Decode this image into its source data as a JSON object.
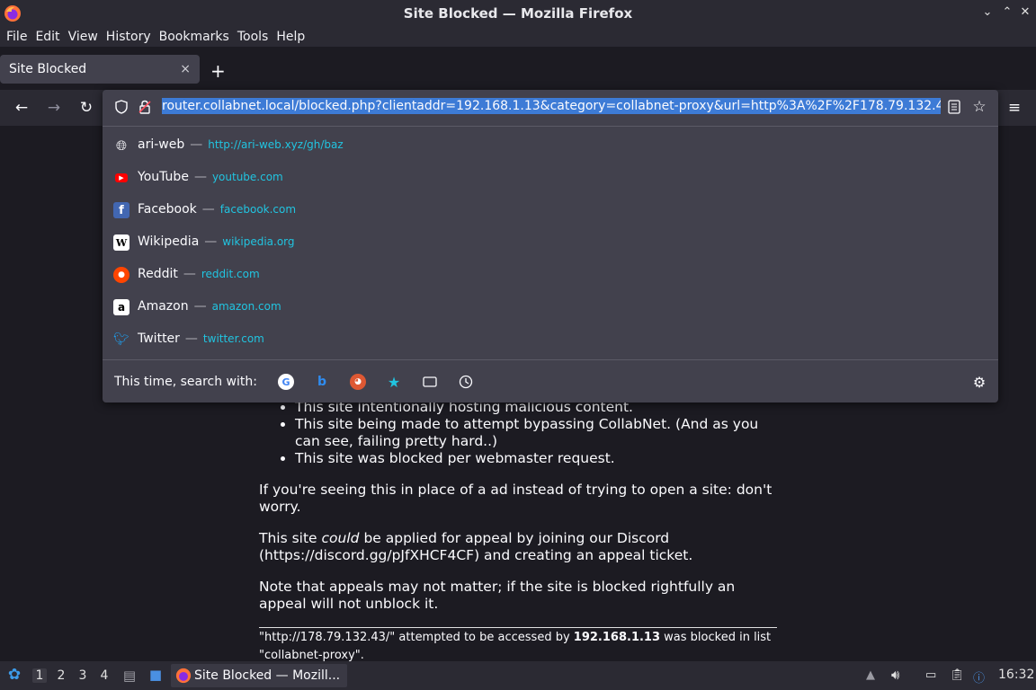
{
  "window": {
    "title": "Site Blocked — Mozilla Firefox"
  },
  "menu": [
    "File",
    "Edit",
    "View",
    "History",
    "Bookmarks",
    "Tools",
    "Help"
  ],
  "tab": {
    "title": "Site Blocked",
    "close": "×"
  },
  "urlbar": {
    "url": "router.collabnet.local/blocked.php?clientaddr=192.168.1.13&category=collabnet-proxy&url=http%3A%2F%2F178.79.132.4"
  },
  "suggestions": [
    {
      "name": "ari-web",
      "url": "http://ari-web.xyz/gh/baz",
      "icon": "globe-icon"
    },
    {
      "name": "YouTube",
      "url": "youtube.com",
      "icon": "youtube-icon"
    },
    {
      "name": "Facebook",
      "url": "facebook.com",
      "icon": "facebook-icon"
    },
    {
      "name": "Wikipedia",
      "url": "wikipedia.org",
      "icon": "wikipedia-icon"
    },
    {
      "name": "Reddit",
      "url": "reddit.com",
      "icon": "reddit-icon"
    },
    {
      "name": "Amazon",
      "url": "amazon.com",
      "icon": "amazon-icon"
    },
    {
      "name": "Twitter",
      "url": "twitter.com",
      "icon": "twitter-icon"
    }
  ],
  "search_with": {
    "label": "This time, search with:"
  },
  "page": {
    "bullets": [
      "This site intentionally hosting malicious content.",
      "This site being made to attempt bypassing CollabNet. (And as you can see, failing pretty hard..)",
      "This site was blocked per webmaster request."
    ],
    "para1": "If you're seeing this in place of a ad instead of trying to open a site: don't worry.",
    "para2_pre": "This site ",
    "para2_em": "could",
    "para2_post": " be applied for appeal by joining our Discord (https://discord.gg/pJfXHCF4CF) and creating an appeal ticket.",
    "para3": "Note that appeals may not matter; if the site is blocked rightfully an appeal will not unblock it.",
    "foot_pre": "\"http://178.79.132.43/\" attempted to be accessed by ",
    "foot_ip": "192.168.1.13",
    "foot_post": " was blocked in list \"collabnet-proxy\"."
  },
  "taskbar": {
    "workspaces": [
      "1",
      "2",
      "3",
      "4"
    ],
    "window_title": "Site Blocked — Mozill...",
    "clock": "16:32"
  },
  "colors": {
    "accent": "#3d7bd6",
    "link": "#21c4e0"
  }
}
